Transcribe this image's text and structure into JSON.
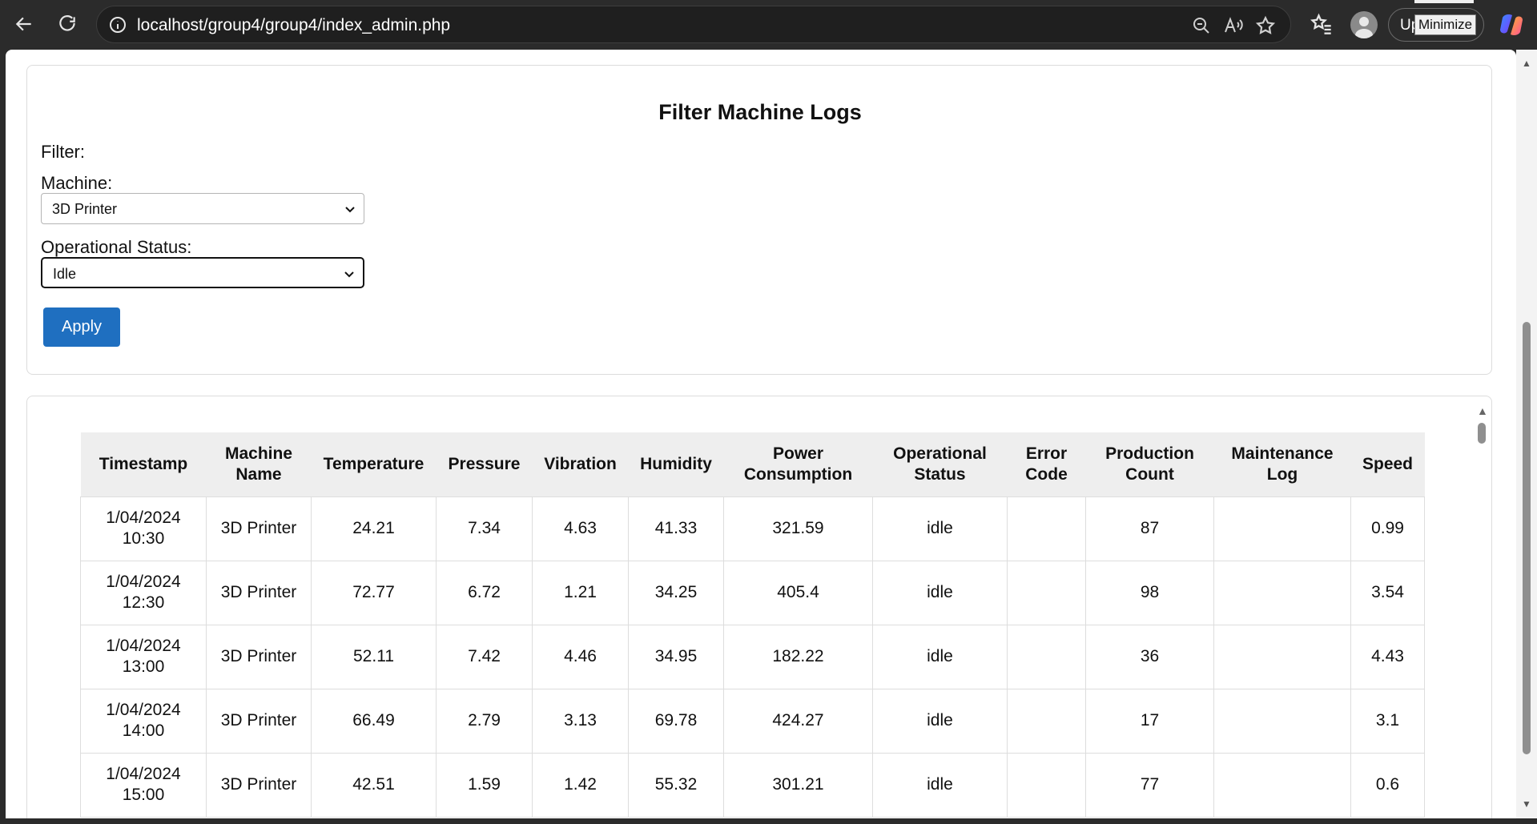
{
  "browser": {
    "url": "localhost/group4/group4/index_admin.php",
    "update_label": "Up",
    "tooltip": "Minimize"
  },
  "filter": {
    "title": "Filter Machine Logs",
    "filter_label": "Filter:",
    "machine_label": "Machine:",
    "machine_value": "3D Printer",
    "status_label": "Operational Status:",
    "status_value": "Idle",
    "apply_label": "Apply"
  },
  "table": {
    "headers": [
      "Timestamp",
      "Machine Name",
      "Temperature",
      "Pressure",
      "Vibration",
      "Humidity",
      "Power Consumption",
      "Operational Status",
      "Error Code",
      "Production Count",
      "Maintenance Log",
      "Speed"
    ],
    "rows": [
      [
        "1/04/2024 10:30",
        "3D Printer",
        "24.21",
        "7.34",
        "4.63",
        "41.33",
        "321.59",
        "idle",
        "",
        "87",
        "",
        "0.99"
      ],
      [
        "1/04/2024 12:30",
        "3D Printer",
        "72.77",
        "6.72",
        "1.21",
        "34.25",
        "405.4",
        "idle",
        "",
        "98",
        "",
        "3.54"
      ],
      [
        "1/04/2024 13:00",
        "3D Printer",
        "52.11",
        "7.42",
        "4.46",
        "34.95",
        "182.22",
        "idle",
        "",
        "36",
        "",
        "4.43"
      ],
      [
        "1/04/2024 14:00",
        "3D Printer",
        "66.49",
        "2.79",
        "3.13",
        "69.78",
        "424.27",
        "idle",
        "",
        "17",
        "",
        "3.1"
      ],
      [
        "1/04/2024 15:00",
        "3D Printer",
        "42.51",
        "1.59",
        "1.42",
        "55.32",
        "301.21",
        "idle",
        "",
        "77",
        "",
        "0.6"
      ]
    ]
  }
}
